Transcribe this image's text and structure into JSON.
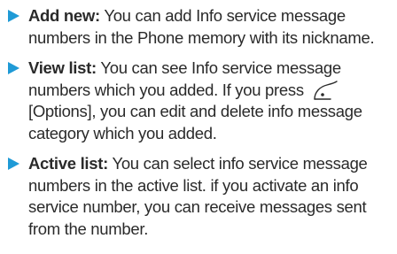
{
  "colors": {
    "bullet": "#1f9ad6",
    "text": "#2a2a2a"
  },
  "items": [
    {
      "term": "Add new:",
      "text": " You can add Info service message numbers in the Phone memory with its nickname."
    },
    {
      "term": "View list:",
      "text_before_icon": " You can see Info service message numbers which you added. If you press ",
      "icon": "left-soft-key-icon",
      "text_after_icon": " [Options], you can edit and delete info message category which you added."
    },
    {
      "term": "Active list:",
      "text": " You can select info service message numbers in the active list. if you activate an info service number, you can receive messages sent from the number."
    }
  ]
}
